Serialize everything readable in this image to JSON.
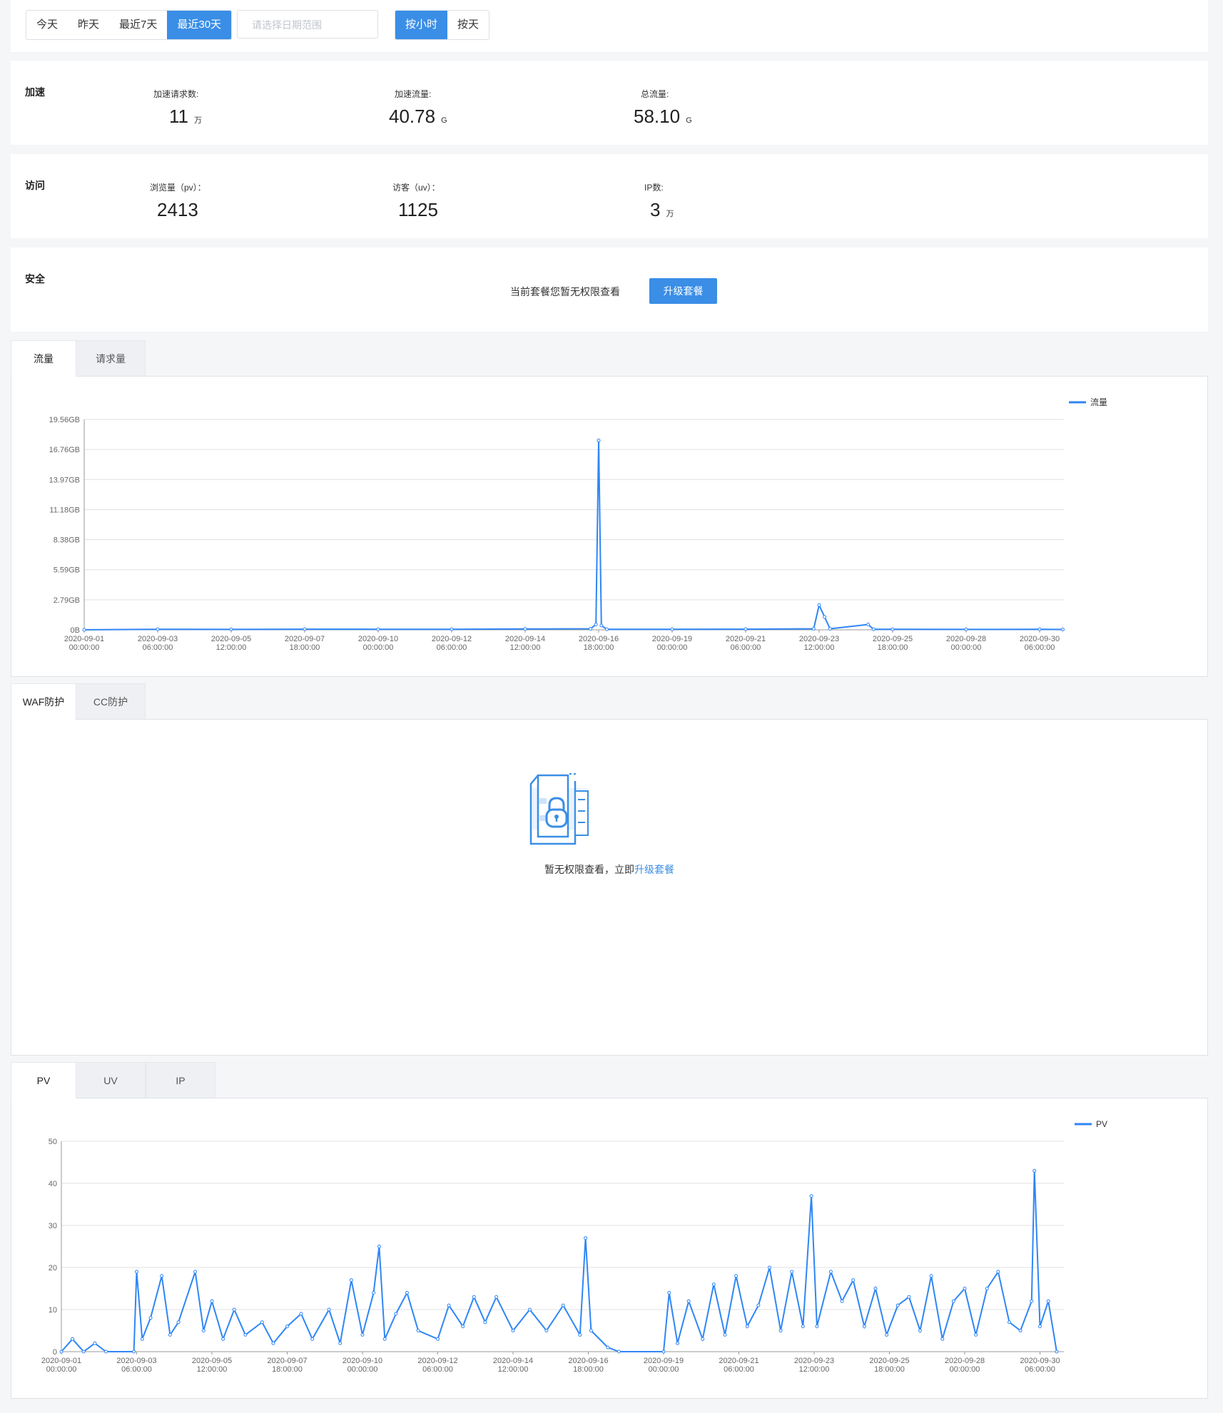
{
  "toolbar": {
    "range_options": [
      "今天",
      "昨天",
      "最近7天",
      "最近30天"
    ],
    "range_active": 3,
    "date_placeholder": "请选择日期范围",
    "granularity_options": [
      "按小时",
      "按天"
    ],
    "granularity_active": 0
  },
  "accel": {
    "title": "加速",
    "stats": [
      {
        "label": "加速请求数:",
        "value": "11",
        "unit": "万"
      },
      {
        "label": "加速流量:",
        "value": "40.78",
        "unit": "G"
      },
      {
        "label": "总流量:",
        "value": "58.10",
        "unit": "G"
      }
    ]
  },
  "visit": {
    "title": "访问",
    "stats": [
      {
        "label": "浏览量（pv）：",
        "value": "2413",
        "unit": ""
      },
      {
        "label": "访客（uv）：",
        "value": "1125",
        "unit": ""
      },
      {
        "label": "IP数:",
        "value": "3",
        "unit": "万"
      }
    ]
  },
  "security": {
    "title": "安全",
    "message": "当前套餐您暂无权限查看",
    "button": "升级套餐"
  },
  "traffic_tabs": [
    "流量",
    "请求量"
  ],
  "protect_tabs": [
    "WAF防护",
    "CC防护"
  ],
  "protect_msg_prefix": "暂无权限查看，立即",
  "protect_msg_link": "升级套餐",
  "pv_tabs": [
    "PV",
    "UV",
    "IP"
  ],
  "colors": {
    "accent": "#3a8ee6",
    "line": "#2f86f6",
    "grid": "#e0e0e0"
  },
  "chart_data": [
    {
      "type": "line",
      "series": [
        {
          "name": "流量"
        }
      ],
      "ytick_labels": [
        "0B",
        "2.79GB",
        "5.59GB",
        "8.38GB",
        "11.18GB",
        "13.97GB",
        "16.76GB",
        "19.56GB"
      ],
      "ylim": [
        0,
        19.56
      ],
      "x_ticks": [
        [
          "2020-09-01",
          "00:00:00"
        ],
        [
          "2020-09-03",
          "06:00:00"
        ],
        [
          "2020-09-05",
          "12:00:00"
        ],
        [
          "2020-09-07",
          "18:00:00"
        ],
        [
          "2020-09-10",
          "00:00:00"
        ],
        [
          "2020-09-12",
          "06:00:00"
        ],
        [
          "2020-09-14",
          "12:00:00"
        ],
        [
          "2020-09-16",
          "18:00:00"
        ],
        [
          "2020-09-19",
          "00:00:00"
        ],
        [
          "2020-09-21",
          "06:00:00"
        ],
        [
          "2020-09-23",
          "12:00:00"
        ],
        [
          "2020-09-25",
          "18:00:00"
        ],
        [
          "2020-09-28",
          "00:00:00"
        ],
        [
          "2020-09-30",
          "06:00:00"
        ]
      ],
      "points": [
        [
          "2020-09-01 00:00",
          0
        ],
        [
          "2020-09-03 06:00",
          0.05
        ],
        [
          "2020-09-05 12:00",
          0.04
        ],
        [
          "2020-09-07 18:00",
          0.06
        ],
        [
          "2020-09-10 00:00",
          0.05
        ],
        [
          "2020-09-12 06:00",
          0.05
        ],
        [
          "2020-09-14 12:00",
          0.08
        ],
        [
          "2020-09-16 12:00",
          0.1
        ],
        [
          "2020-09-16 16:00",
          0.5
        ],
        [
          "2020-09-16 18:00",
          17.6
        ],
        [
          "2020-09-16 20:00",
          0.4
        ],
        [
          "2020-09-17 00:00",
          0.05
        ],
        [
          "2020-09-19 00:00",
          0.05
        ],
        [
          "2020-09-21 06:00",
          0.06
        ],
        [
          "2020-09-23 08:00",
          0.1
        ],
        [
          "2020-09-23 12:00",
          2.3
        ],
        [
          "2020-09-23 16:00",
          1.2
        ],
        [
          "2020-09-23 20:00",
          0.1
        ],
        [
          "2020-09-25 00:00",
          0.5
        ],
        [
          "2020-09-25 04:00",
          0.05
        ],
        [
          "2020-09-25 18:00",
          0.05
        ],
        [
          "2020-09-28 00:00",
          0.04
        ],
        [
          "2020-09-30 06:00",
          0.05
        ],
        [
          "2020-09-30 23:00",
          0.03
        ]
      ],
      "grid": true,
      "legend": "top-right"
    },
    {
      "type": "line",
      "series": [
        {
          "name": "PV"
        }
      ],
      "ytick_labels": [
        "0",
        "10",
        "20",
        "30",
        "40",
        "50"
      ],
      "ylim": [
        0,
        50
      ],
      "x_ticks": [
        [
          "2020-09-01",
          "00:00:00"
        ],
        [
          "2020-09-03",
          "06:00:00"
        ],
        [
          "2020-09-05",
          "12:00:00"
        ],
        [
          "2020-09-07",
          "18:00:00"
        ],
        [
          "2020-09-10",
          "00:00:00"
        ],
        [
          "2020-09-12",
          "06:00:00"
        ],
        [
          "2020-09-14",
          "12:00:00"
        ],
        [
          "2020-09-16",
          "18:00:00"
        ],
        [
          "2020-09-19",
          "00:00:00"
        ],
        [
          "2020-09-21",
          "06:00:00"
        ],
        [
          "2020-09-23",
          "12:00:00"
        ],
        [
          "2020-09-25",
          "18:00:00"
        ],
        [
          "2020-09-28",
          "00:00:00"
        ],
        [
          "2020-09-30",
          "06:00:00"
        ]
      ],
      "points": [
        [
          "2020-09-01 00:00",
          0
        ],
        [
          "2020-09-01 08:00",
          3
        ],
        [
          "2020-09-01 16:00",
          0
        ],
        [
          "2020-09-02 00:00",
          2
        ],
        [
          "2020-09-02 08:00",
          0
        ],
        [
          "2020-09-03 04:00",
          0
        ],
        [
          "2020-09-03 06:00",
          19
        ],
        [
          "2020-09-03 10:00",
          3
        ],
        [
          "2020-09-03 16:00",
          8
        ],
        [
          "2020-09-04 00:00",
          18
        ],
        [
          "2020-09-04 06:00",
          4
        ],
        [
          "2020-09-04 12:00",
          7
        ],
        [
          "2020-09-05 00:00",
          19
        ],
        [
          "2020-09-05 06:00",
          5
        ],
        [
          "2020-09-05 12:00",
          12
        ],
        [
          "2020-09-05 20:00",
          3
        ],
        [
          "2020-09-06 04:00",
          10
        ],
        [
          "2020-09-06 12:00",
          4
        ],
        [
          "2020-09-07 00:00",
          7
        ],
        [
          "2020-09-07 08:00",
          2
        ],
        [
          "2020-09-07 18:00",
          6
        ],
        [
          "2020-09-08 04:00",
          9
        ],
        [
          "2020-09-08 12:00",
          3
        ],
        [
          "2020-09-09 00:00",
          10
        ],
        [
          "2020-09-09 08:00",
          2
        ],
        [
          "2020-09-09 16:00",
          17
        ],
        [
          "2020-09-10 00:00",
          4
        ],
        [
          "2020-09-10 08:00",
          14
        ],
        [
          "2020-09-10 12:00",
          25
        ],
        [
          "2020-09-10 16:00",
          3
        ],
        [
          "2020-09-11 00:00",
          9
        ],
        [
          "2020-09-11 08:00",
          14
        ],
        [
          "2020-09-11 16:00",
          5
        ],
        [
          "2020-09-12 06:00",
          3
        ],
        [
          "2020-09-12 14:00",
          11
        ],
        [
          "2020-09-13 00:00",
          6
        ],
        [
          "2020-09-13 08:00",
          13
        ],
        [
          "2020-09-13 16:00",
          7
        ],
        [
          "2020-09-14 00:00",
          13
        ],
        [
          "2020-09-14 12:00",
          5
        ],
        [
          "2020-09-15 00:00",
          10
        ],
        [
          "2020-09-15 12:00",
          5
        ],
        [
          "2020-09-16 00:00",
          11
        ],
        [
          "2020-09-16 12:00",
          4
        ],
        [
          "2020-09-16 16:00",
          27
        ],
        [
          "2020-09-16 20:00",
          5
        ],
        [
          "2020-09-17 08:00",
          1
        ],
        [
          "2020-09-17 16:00",
          0
        ],
        [
          "2020-09-19 00:00",
          0
        ],
        [
          "2020-09-19 04:00",
          14
        ],
        [
          "2020-09-19 10:00",
          2
        ],
        [
          "2020-09-19 18:00",
          12
        ],
        [
          "2020-09-20 04:00",
          3
        ],
        [
          "2020-09-20 12:00",
          16
        ],
        [
          "2020-09-20 20:00",
          4
        ],
        [
          "2020-09-21 04:00",
          18
        ],
        [
          "2020-09-21 12:00",
          6
        ],
        [
          "2020-09-21 20:00",
          11
        ],
        [
          "2020-09-22 04:00",
          20
        ],
        [
          "2020-09-22 12:00",
          5
        ],
        [
          "2020-09-22 20:00",
          19
        ],
        [
          "2020-09-23 04:00",
          6
        ],
        [
          "2020-09-23 10:00",
          37
        ],
        [
          "2020-09-23 14:00",
          6
        ],
        [
          "2020-09-24 00:00",
          19
        ],
        [
          "2020-09-24 08:00",
          12
        ],
        [
          "2020-09-24 16:00",
          17
        ],
        [
          "2020-09-25 00:00",
          6
        ],
        [
          "2020-09-25 08:00",
          15
        ],
        [
          "2020-09-25 16:00",
          4
        ],
        [
          "2020-09-26 00:00",
          11
        ],
        [
          "2020-09-26 08:00",
          13
        ],
        [
          "2020-09-26 16:00",
          5
        ],
        [
          "2020-09-27 00:00",
          18
        ],
        [
          "2020-09-27 08:00",
          3
        ],
        [
          "2020-09-27 16:00",
          12
        ],
        [
          "2020-09-28 00:00",
          15
        ],
        [
          "2020-09-28 08:00",
          4
        ],
        [
          "2020-09-28 16:00",
          15
        ],
        [
          "2020-09-29 00:00",
          19
        ],
        [
          "2020-09-29 08:00",
          7
        ],
        [
          "2020-09-29 16:00",
          5
        ],
        [
          "2020-09-30 00:00",
          12
        ],
        [
          "2020-09-30 02:00",
          43
        ],
        [
          "2020-09-30 06:00",
          6
        ],
        [
          "2020-09-30 12:00",
          12
        ],
        [
          "2020-09-30 18:00",
          0
        ]
      ],
      "grid": true,
      "legend": "top-right"
    }
  ]
}
